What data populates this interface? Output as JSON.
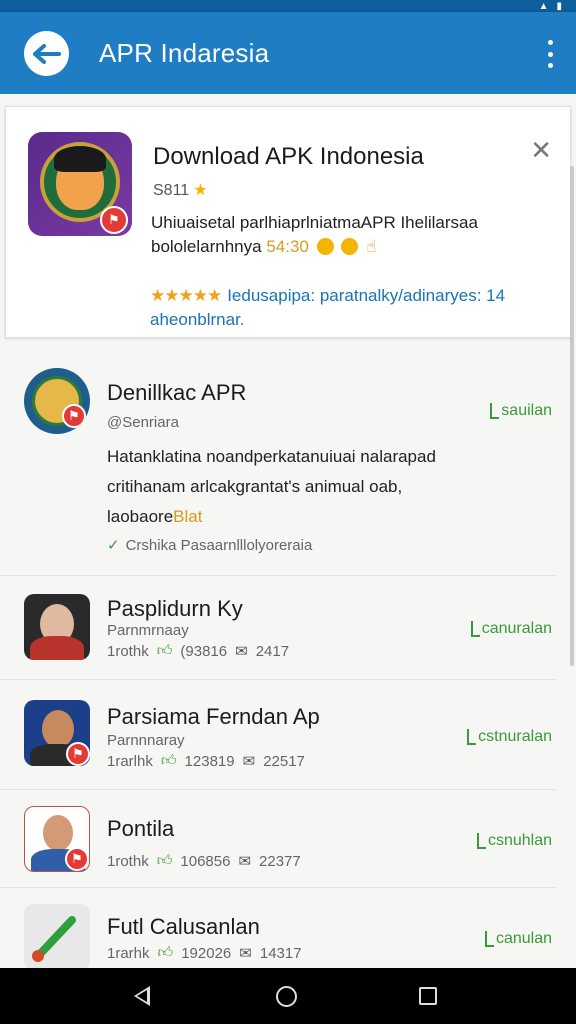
{
  "appbar": {
    "title": "APR Indaresia"
  },
  "featured": {
    "title": "Download APK Indonesia",
    "version": "S811",
    "desc_line1": "Uhiuaisetal parlhiaprlniatmaAPR Ihelilarsaa",
    "desc_line2_text": "bololelarnhnya",
    "desc_line2_num": "54:30",
    "rating_stars": "★★★★★",
    "rating_text": "Iedusapipa: paratnalky/adinaryes: 14",
    "rating_text2": "aheonblrnar."
  },
  "list": [
    {
      "name": "Denillkac APR",
      "sub": "@Senriara",
      "action": "sauilan",
      "desc_line1": "Hatanklatina noandperkatanuiuai nalarapad",
      "desc_line2": "critihanam arlcakgrantat's animual oab,",
      "desc_line3_text": "laobaore",
      "desc_line3_hl": "Blat",
      "tag": "Crshika Pasaarnlllolyoreraia"
    },
    {
      "name": "Pasplidurn Ky",
      "sub": "Parnmrnaay",
      "stat_label": "1rothk",
      "stat_a": "(93816",
      "stat_b": "2417",
      "action": "canuralan"
    },
    {
      "name": "Parsiama Ferndan Ap",
      "sub": "Parnnnaray",
      "stat_label": "1rarlhk",
      "stat_a": "123819",
      "stat_b": "22517",
      "action": "cstnuralan"
    },
    {
      "name": "Pontila",
      "stat_label": "1rothk",
      "stat_a": "106856",
      "stat_b": "22377",
      "action": "csnuhlan"
    },
    {
      "name": "Futl Calusanlan",
      "stat_label": "1rarhk",
      "stat_a": "192026",
      "stat_b": "14317",
      "action": "canulan"
    }
  ],
  "colors": {
    "appbar": "#1f7dc4",
    "statusbar": "#0d5f9e",
    "accent_green": "#3a9a3a",
    "link_blue": "#1a73b7"
  }
}
